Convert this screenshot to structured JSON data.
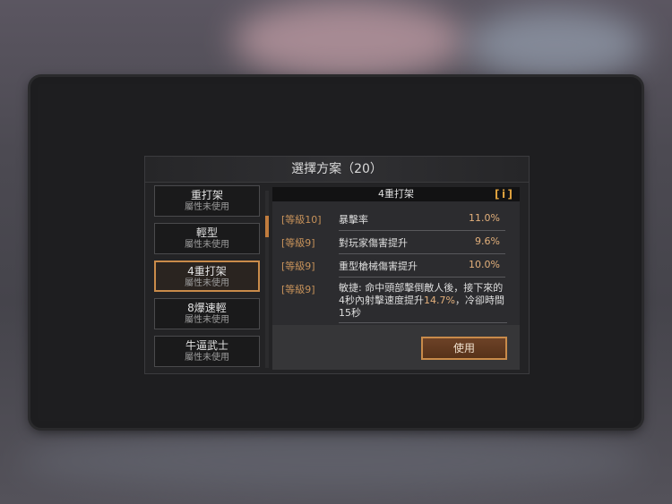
{
  "dialog": {
    "title": "選擇方案（20）",
    "schemes": [
      {
        "name": "重打架",
        "status": "屬性未使用"
      },
      {
        "name": "輕型",
        "status": "屬性未使用"
      },
      {
        "name": "4重打架",
        "status": "屬性未使用"
      },
      {
        "name": "8爆速輕",
        "status": "屬性未使用"
      },
      {
        "name": "牛逼武士",
        "status": "屬性未使用"
      }
    ],
    "selected_index": 2,
    "detail": {
      "title": "4重打架",
      "info_icon": "i",
      "attributes": [
        {
          "level": "[等級10]",
          "name": "暴擊率",
          "value": "11.0%"
        },
        {
          "level": "[等級9]",
          "name": "對玩家傷害提升",
          "value": "9.6%"
        },
        {
          "level": "[等級9]",
          "name": "重型槍械傷害提升",
          "value": "10.0%"
        }
      ],
      "special": {
        "level": "[等級9]",
        "text_a": "敏捷: 命中頭部擊倒敵人後，接下來的4秒內射擊速度提升",
        "highlight": "14.7%",
        "text_b": "，冷卻時間15秒"
      }
    },
    "use_label": "使用"
  },
  "colors": {
    "accent": "#c98b4a",
    "value": "#e3b07b",
    "level": "#c7925a"
  },
  "icons": {
    "info": "info-icon"
  }
}
